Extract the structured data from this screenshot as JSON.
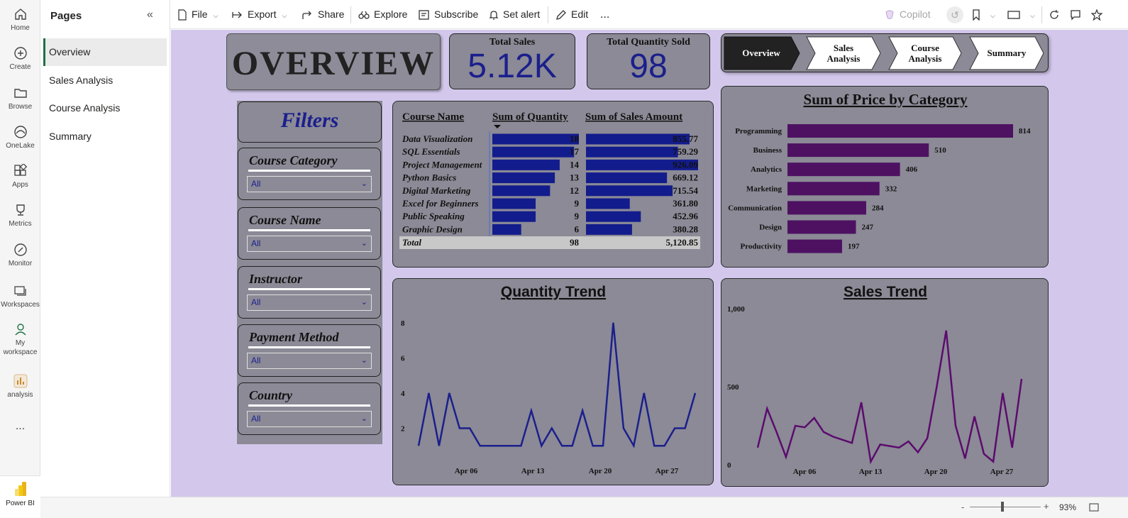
{
  "rail": {
    "items": [
      {
        "label": "Home"
      },
      {
        "label": "Create"
      },
      {
        "label": "Browse"
      },
      {
        "label": "OneLake"
      },
      {
        "label": "Apps"
      },
      {
        "label": "Metrics"
      },
      {
        "label": "Monitor"
      },
      {
        "label": "Workspaces"
      },
      {
        "label": "My workspace"
      },
      {
        "label": "analysis"
      }
    ],
    "more": "...",
    "product": "Power BI"
  },
  "pages": {
    "title": "Pages",
    "items": [
      {
        "label": "Overview",
        "active": true
      },
      {
        "label": "Sales Analysis"
      },
      {
        "label": "Course Analysis"
      },
      {
        "label": "Summary"
      }
    ]
  },
  "toolbar": {
    "file": "File",
    "export": "Export",
    "share": "Share",
    "explore": "Explore",
    "subscribe": "Subscribe",
    "set_alert": "Set alert",
    "edit": "Edit",
    "more": "...",
    "copilot": "Copilot"
  },
  "report": {
    "title": "OVERVIEW",
    "kpis": [
      {
        "label": "Total Sales",
        "value": "5.12K"
      },
      {
        "label": "Total Quantity Sold",
        "value": "98"
      }
    ],
    "nav_buttons": [
      "Overview",
      "Sales Analysis",
      "Course Analysis",
      "Summary"
    ],
    "active_nav": "Overview",
    "filters": {
      "title": "Filters",
      "slicers": [
        {
          "label": "Course Category",
          "value": "All"
        },
        {
          "label": "Course Name",
          "value": "All"
        },
        {
          "label": "Instructor",
          "value": "All"
        },
        {
          "label": "Payment Method",
          "value": "All"
        },
        {
          "label": "Country",
          "value": "All"
        }
      ]
    },
    "table": {
      "columns": [
        "Course Name",
        "Sum of Quantity",
        "Sum of Sales Amount"
      ],
      "rows": [
        {
          "name": "Data Visualization",
          "qty": 18,
          "sales": "855.77",
          "sales_num": 855.77
        },
        {
          "name": "SQL Essentials",
          "qty": 17,
          "sales": "759.29",
          "sales_num": 759.29
        },
        {
          "name": "Project Management",
          "qty": 14,
          "sales": "926.09",
          "sales_num": 926.09
        },
        {
          "name": "Python Basics",
          "qty": 13,
          "sales": "669.12",
          "sales_num": 669.12
        },
        {
          "name": "Digital Marketing",
          "qty": 12,
          "sales": "715.54",
          "sales_num": 715.54
        },
        {
          "name": "Excel for Beginners",
          "qty": 9,
          "sales": "361.80",
          "sales_num": 361.8
        },
        {
          "name": "Public Speaking",
          "qty": 9,
          "sales": "452.96",
          "sales_num": 452.96
        },
        {
          "name": "Graphic Design",
          "qty": 6,
          "sales": "380.28",
          "sales_num": 380.28
        }
      ],
      "total": {
        "label": "Total",
        "qty": "98",
        "sales": "5,120.85"
      }
    },
    "colors": {
      "canvas": "#d3c8ec",
      "card": "#8b8a96",
      "bar_blue": "#131c8c",
      "bar_purple": "#4e1162",
      "line_blue": "#1b1f8c",
      "line_purple": "#5c0b6e"
    }
  },
  "chart_data": [
    {
      "type": "bar",
      "orientation": "horizontal",
      "title": "Sum of Price by Category",
      "categories": [
        "Programming",
        "Business",
        "Analytics",
        "Marketing",
        "Communication",
        "Design",
        "Productivity"
      ],
      "values": [
        814,
        510,
        406,
        332,
        284,
        247,
        197
      ],
      "xlim": [
        0,
        900
      ],
      "grid": false,
      "legend": "none"
    },
    {
      "type": "line",
      "title": "Quantity Trend",
      "x": [
        "Apr 01",
        "Apr 02",
        "Apr 03",
        "Apr 04",
        "Apr 05",
        "Apr 06",
        "Apr 07",
        "Apr 08",
        "Apr 09",
        "Apr 10",
        "Apr 11",
        "Apr 12",
        "Apr 13",
        "Apr 14",
        "Apr 15",
        "Apr 16",
        "Apr 17",
        "Apr 18",
        "Apr 19",
        "Apr 20",
        "Apr 21",
        "Apr 22",
        "Apr 23",
        "Apr 24",
        "Apr 25",
        "Apr 26",
        "Apr 27",
        "Apr 28",
        "Apr 29",
        "Apr 30"
      ],
      "values": [
        1,
        4,
        1,
        4,
        2,
        2,
        1,
        1,
        1,
        1,
        1,
        3,
        1,
        2,
        1,
        1,
        3,
        1,
        1,
        8,
        2,
        1,
        4,
        1,
        1,
        2,
        2,
        4
      ],
      "x_ticks": [
        "Apr 06",
        "Apr 13",
        "Apr 20",
        "Apr 27"
      ],
      "y_ticks": [
        "2",
        "4",
        "6",
        "8"
      ],
      "ylim": [
        0,
        8.8
      ],
      "grid": false
    },
    {
      "type": "line",
      "title": "Sales Trend",
      "values": [
        110,
        360,
        210,
        50,
        250,
        240,
        300,
        210,
        180,
        160,
        140,
        400,
        20,
        130,
        120,
        110,
        150,
        80,
        170,
        500,
        860,
        250,
        40,
        310,
        70,
        20,
        460,
        110,
        550
      ],
      "x_ticks": [
        "Apr 06",
        "Apr 13",
        "Apr 20",
        "Apr 27"
      ],
      "y_ticks": [
        "0",
        "500",
        "1,000"
      ],
      "ylim": [
        0,
        1000
      ],
      "grid": false
    }
  ],
  "statusbar": {
    "zoom": "93%",
    "minus": "-",
    "plus": "+"
  }
}
